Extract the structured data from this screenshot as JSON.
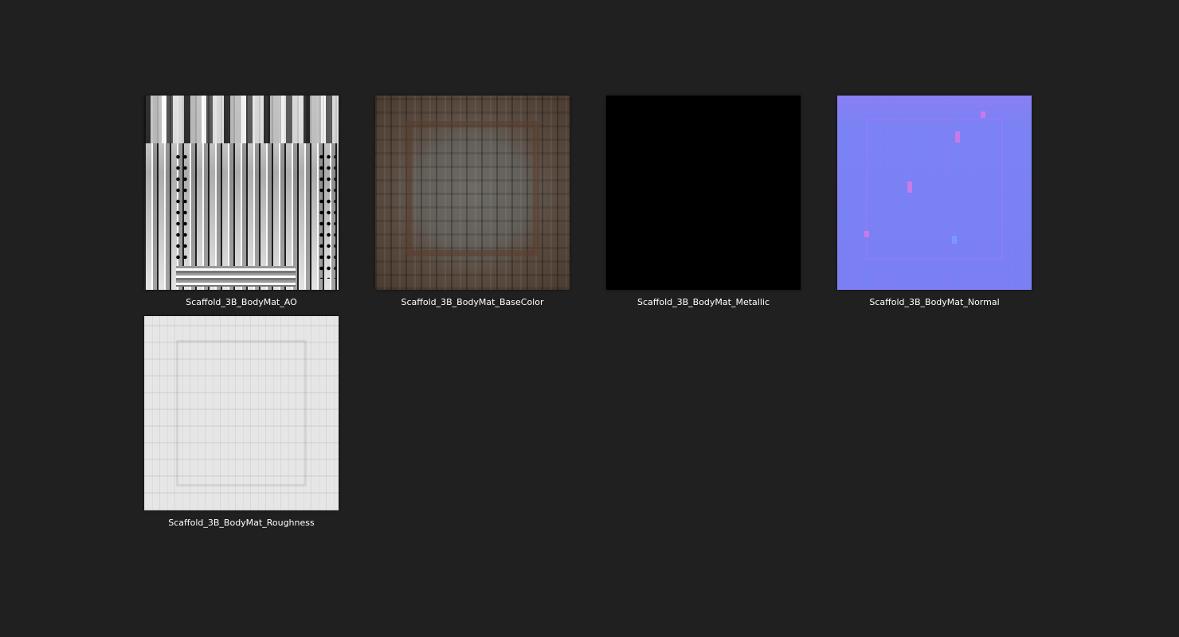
{
  "files": [
    {
      "name": "Scaffold_3B_BodyMat_AO",
      "kind": "ao"
    },
    {
      "name": "Scaffold_3B_BodyMat_BaseColor",
      "kind": "basecolor"
    },
    {
      "name": "Scaffold_3B_BodyMat_Metallic",
      "kind": "metallic"
    },
    {
      "name": "Scaffold_3B_BodyMat_Normal",
      "kind": "normal"
    },
    {
      "name": "Scaffold_3B_BodyMat_Roughness",
      "kind": "rough"
    }
  ],
  "colors": {
    "background": "#202020",
    "label_text": "#ffffff",
    "normal_map": "#7a80f2",
    "metallic_map": "#000000"
  }
}
